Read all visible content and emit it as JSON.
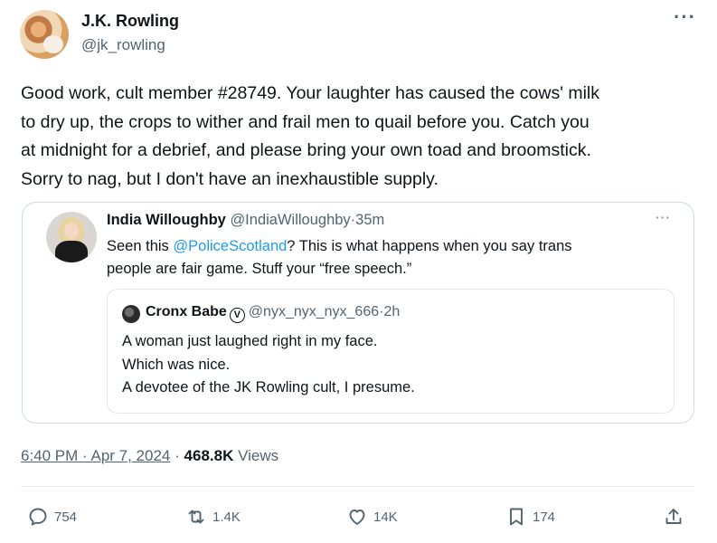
{
  "author": {
    "name": "J.K. Rowling",
    "handle": "@jk_rowling"
  },
  "more_icon": "···",
  "tweet_lines": [
    "Good work, cult member #28749. Your laughter has caused the cows' milk",
    "to dry up, the crops to wither and frail men to quail before you. Catch you",
    "at midnight for a debrief, and please bring your own toad and broomstick.",
    "Sorry to nag, but I don't have an inexhaustible supply."
  ],
  "quoted": {
    "name": "India Willoughby",
    "handle": "@IndiaWilloughby",
    "time": "35m",
    "line1_before": "Seen this ",
    "mention": "@PoliceScotland",
    "line1_after": "? This is what happens when you say trans",
    "line2": "people are fair game. Stuff your “free speech.”",
    "nested": {
      "name": "Cronx Babe",
      "verified_glyph": "V",
      "handle": "@nyx_nyx_nyx_666",
      "time": "2h",
      "lines": [
        "A woman just laughed right in my face.",
        "Which was nice.",
        "A devotee of the JK Rowling cult, I presume."
      ]
    }
  },
  "timestamp": "6:40 PM · Apr 7, 2024",
  "separator": "·",
  "views_count": "468.8K",
  "views_label": "Views",
  "actions": {
    "replies": "754",
    "reposts": "1.4K",
    "likes": "14K",
    "bookmarks": "174"
  },
  "icons": {
    "reply": "reply-icon",
    "repost": "repost-icon",
    "like": "heart-icon",
    "bookmark": "bookmark-icon",
    "share": "share-icon"
  },
  "colors": {
    "link": "#1d9bf0",
    "secondary_text": "#536471",
    "border": "#cfd9de"
  }
}
